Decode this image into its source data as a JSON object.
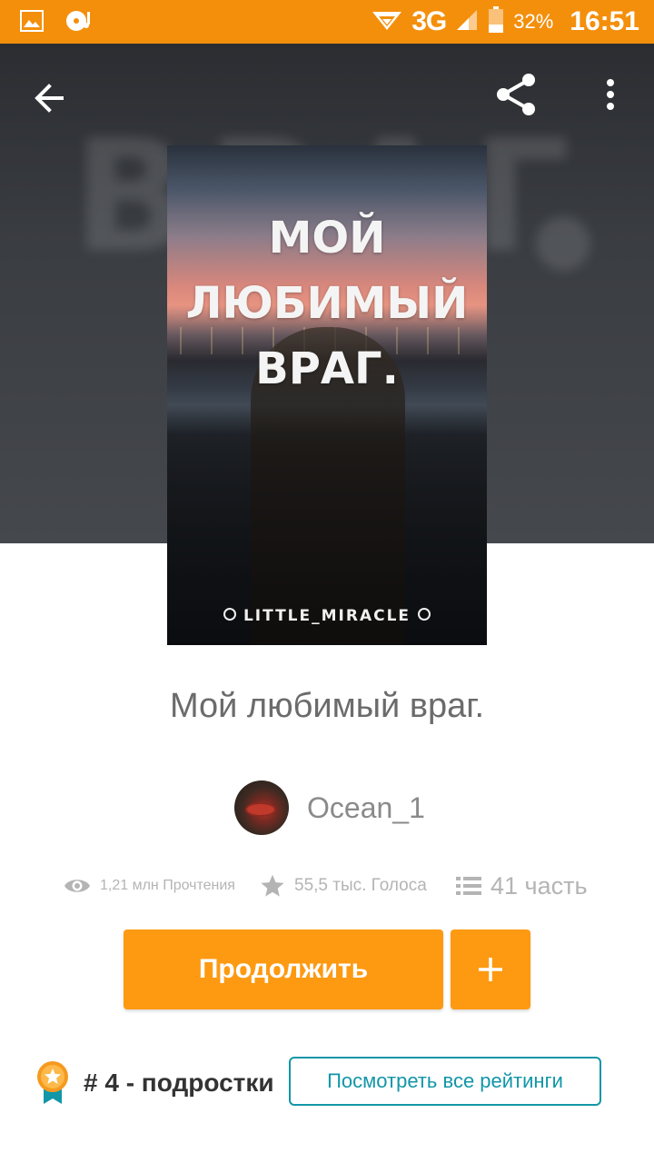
{
  "status_bar": {
    "network": "3G",
    "battery": "32%",
    "time": "16:51"
  },
  "toolbar": {
    "back_icon": "arrow-left-icon",
    "share_icon": "share-icon",
    "more_icon": "more-vertical-icon"
  },
  "cover": {
    "title_lines": [
      "МОЙ",
      "ЛЮБИМЫЙ",
      "ВРАГ."
    ],
    "author": "LITTLE_MIRACLE"
  },
  "story": {
    "title": "Мой любимый враг.",
    "author": "Ocean_1"
  },
  "stats": {
    "reads": "1,21 млн Прочтения",
    "votes": "55,5 тыс. Голоса",
    "parts": "41 часть"
  },
  "actions": {
    "continue_label": "Продолжить",
    "add_label": "+"
  },
  "ranking": {
    "text": "# 4 - подростки",
    "view_all_label": "Посмотреть все рейтинги"
  },
  "colors": {
    "status_bar": "#f48f0c",
    "primary_button": "#fd9a12",
    "link_teal": "#1296a8"
  }
}
